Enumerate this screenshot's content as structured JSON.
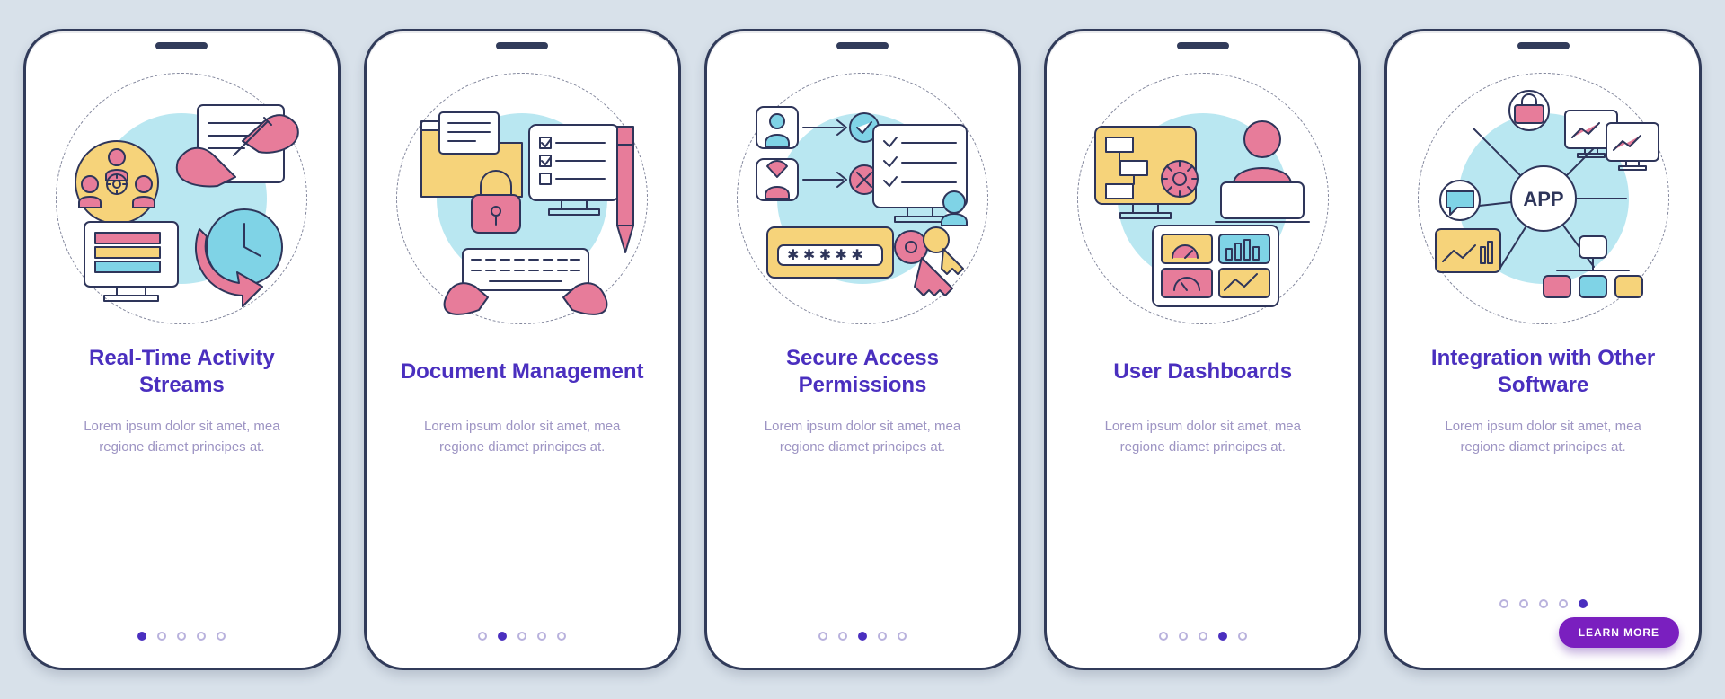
{
  "colors": {
    "background": "#d8e1ea",
    "phone": "#ffffff",
    "frame": "#313b5a",
    "title": "#4a2fbf",
    "body_text": "#9d94c3",
    "accent_yellow": "#f6d37a",
    "accent_pink": "#e77c9a",
    "accent_blue": "#7fd3e6",
    "cta_bg": "#7a1fbf"
  },
  "cta_label": "LEARN MORE",
  "screens": [
    {
      "id": "activity-streams",
      "title": "Real-Time Activity Streams",
      "body": "Lorem ipsum dolor sit amet, mea regione diamet principes at.",
      "active_dot": 0,
      "illustration": "activity-streams-illustration",
      "icons": [
        "team-icon",
        "gear-icon",
        "hands-writing-icon",
        "clock-arrow-icon",
        "monitor-books-icon",
        "document-icon"
      ]
    },
    {
      "id": "document-management",
      "title": "Document Management",
      "body": "Lorem ipsum dolor sit amet, mea regione diamet principes at.",
      "active_dot": 1,
      "illustration": "document-management-illustration",
      "icons": [
        "folder-icon",
        "padlock-icon",
        "checklist-monitor-icon",
        "pen-icon",
        "keyboard-hands-icon"
      ]
    },
    {
      "id": "secure-access",
      "title": "Secure Access Permissions",
      "body": "Lorem ipsum dolor sit amet, mea regione diamet principes at.",
      "active_dot": 2,
      "illustration": "secure-access-illustration",
      "icons": [
        "user-allow-icon",
        "user-deny-icon",
        "checklist-monitor-icon",
        "password-field-icon",
        "keys-icon"
      ]
    },
    {
      "id": "user-dashboards",
      "title": "User Dashboards",
      "body": "Lorem ipsum dolor sit amet, mea regione diamet principes at.",
      "active_dot": 3,
      "illustration": "user-dashboards-illustration",
      "icons": [
        "flowchart-monitor-icon",
        "gear-icon",
        "person-laptop-icon",
        "dashboard-widgets-icon"
      ]
    },
    {
      "id": "integration",
      "title": "Integration with Other Software",
      "body": "Lorem ipsum dolor sit amet, mea regione diamet principes at.",
      "active_dot": 4,
      "illustration": "integration-illustration",
      "icons": [
        "app-node-icon",
        "briefcase-icon",
        "chat-bubble-icon",
        "chart-node-icon",
        "multi-monitor-icon",
        "network-nodes-icon"
      ],
      "app_label": "APP",
      "has_cta": true
    }
  ],
  "dots_per_screen": 5
}
